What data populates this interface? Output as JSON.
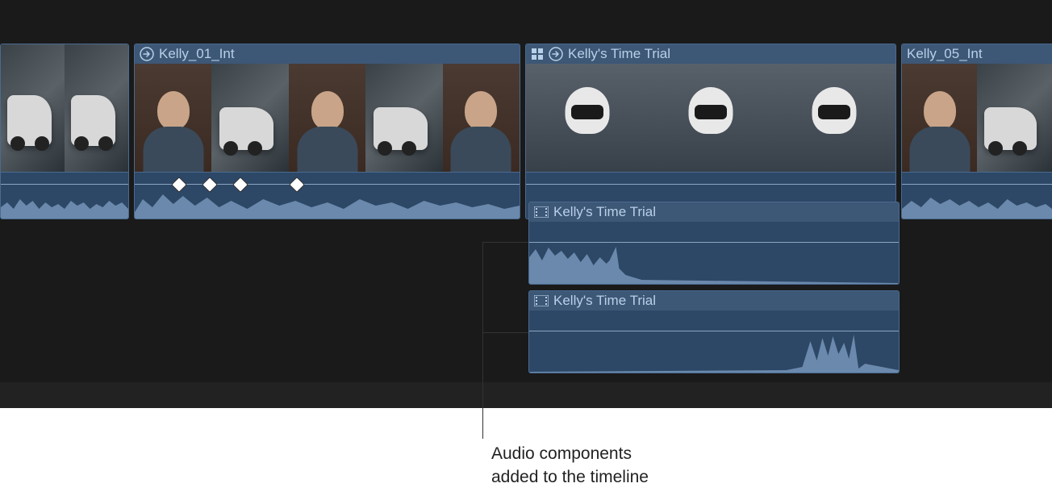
{
  "clips": [
    {
      "title": ""
    },
    {
      "title": "Kelly_01_Int"
    },
    {
      "title": "Kelly's Time Trial"
    },
    {
      "title": "Kelly_05_Int"
    }
  ],
  "audio_components": [
    {
      "title": "Kelly's Time Trial"
    },
    {
      "title": "Kelly's Time Trial"
    }
  ],
  "annotation": "Audio components\nadded to the timeline",
  "colors": {
    "clip_bg": "#2d4766",
    "clip_border": "#4a6a8f",
    "header_bg": "#3d5776",
    "text": "#b8d0e8",
    "waveform": "#6a89ac",
    "timeline_bg": "#1a1a1a"
  }
}
